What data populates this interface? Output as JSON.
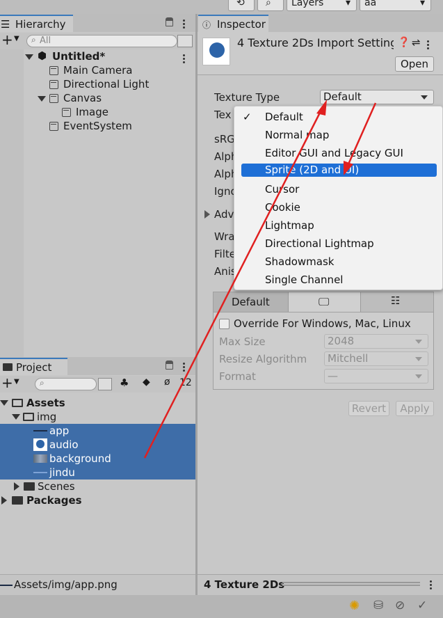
{
  "toolbar": {
    "layers_label": "Layers",
    "layout_label": "aa"
  },
  "hierarchy": {
    "tab": "Hierarchy",
    "search_placeholder": "All",
    "scene": "Untitled*",
    "items": [
      "Main Camera",
      "Directional Light",
      "Canvas",
      "Image",
      "EventSystem"
    ]
  },
  "project": {
    "tab": "Project",
    "hidden_count": "12",
    "assets": "Assets",
    "img": "img",
    "files": [
      "app",
      "audio",
      "background",
      "jindu"
    ],
    "scenes": "Scenes",
    "packages": "Packages",
    "path": "Assets/img/app.png"
  },
  "inspector": {
    "tab": "Inspector",
    "title": "4 Texture 2Ds Import Setting",
    "open_label": "Open",
    "texture_type_label": "Texture Type",
    "texture_type_value": "Default",
    "truncated_labels": [
      "Tex",
      "sRG",
      "Alph",
      "Alph",
      "Igno",
      "Adv",
      "Wra",
      "Filte",
      "Anis"
    ],
    "platform_tabs": [
      "Default"
    ],
    "override_label": "Override For Windows, Mac, Linux",
    "max_size_label": "Max Size",
    "max_size_value": "2048",
    "resize_label": "Resize Algorithm",
    "resize_value": "Mitchell",
    "format_label": "Format",
    "format_value": "—",
    "revert_label": "Revert",
    "apply_label": "Apply",
    "footer": "4 Texture 2Ds"
  },
  "texture_type_menu": {
    "options": [
      "Default",
      "Normal map",
      "Editor GUI and Legacy GUI",
      "Sprite (2D and UI)",
      "Cursor",
      "Cookie",
      "Lightmap",
      "Directional Lightmap",
      "Shadowmask",
      "Single Channel"
    ],
    "checked": "Default",
    "highlighted": "Sprite (2D and UI)"
  },
  "colors": {
    "selection": "#3e6da8",
    "menu_highlight": "#1e6fd6",
    "annotation_arrow": "#e02020"
  }
}
